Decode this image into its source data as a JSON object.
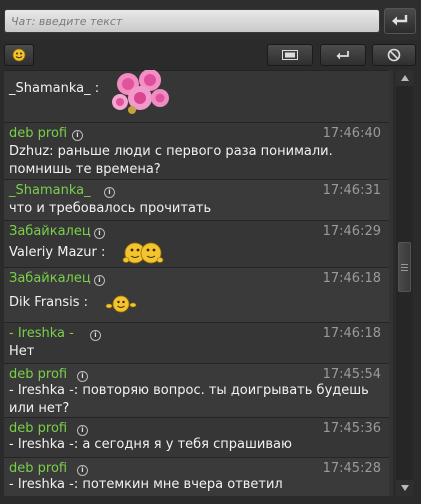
{
  "input": {
    "placeholder": "Чат: введите текст"
  },
  "icons": {
    "send": "enter-arrow-icon",
    "smile": "smiley-icon",
    "list": "window-icon",
    "enter": "enter-arrow-icon",
    "ban": "ban-icon",
    "info": "info-icon",
    "flowers": "pink-roses-icon",
    "hug": "hugging-smileys-icon",
    "dance": "dancing-smiley-icon"
  },
  "colors": {
    "nick": "#7ad04a",
    "time": "#9a9a9a",
    "text": "#f2f2f2",
    "bg": "#2b2b2b"
  },
  "messages": [
    {
      "nick": "",
      "time": "",
      "text": "_Shamanka_ :"
    },
    {
      "nick": "deb profi",
      "time": "17:46:40",
      "text": "Dzhuz: раньше люди с первого раза понимали. помнишь те времена?"
    },
    {
      "nick": "_Shamanka_",
      "time": "17:46:31",
      "text": "что и требовалось прочитать"
    },
    {
      "nick": "Забайкалец",
      "time": "17:46:29",
      "text": "Valeriy Mazur :"
    },
    {
      "nick": "Забайкалец",
      "time": "17:46:18",
      "text": "Dik Fransis :"
    },
    {
      "nick": "- Ireshka -",
      "time": "17:46:18",
      "text": "Нет"
    },
    {
      "nick": "deb profi",
      "time": "17:45:54",
      "text": "- Ireshka -: повторяю вопрос. ты доигрывать будешь или нет?"
    },
    {
      "nick": "deb profi",
      "time": "17:45:36",
      "text": "- Ireshka -: а сегодня я у тебя спрашиваю"
    },
    {
      "nick": "deb profi",
      "time": "17:45:28",
      "text": "- Ireshka -: потемкин мне вчера ответил"
    }
  ]
}
